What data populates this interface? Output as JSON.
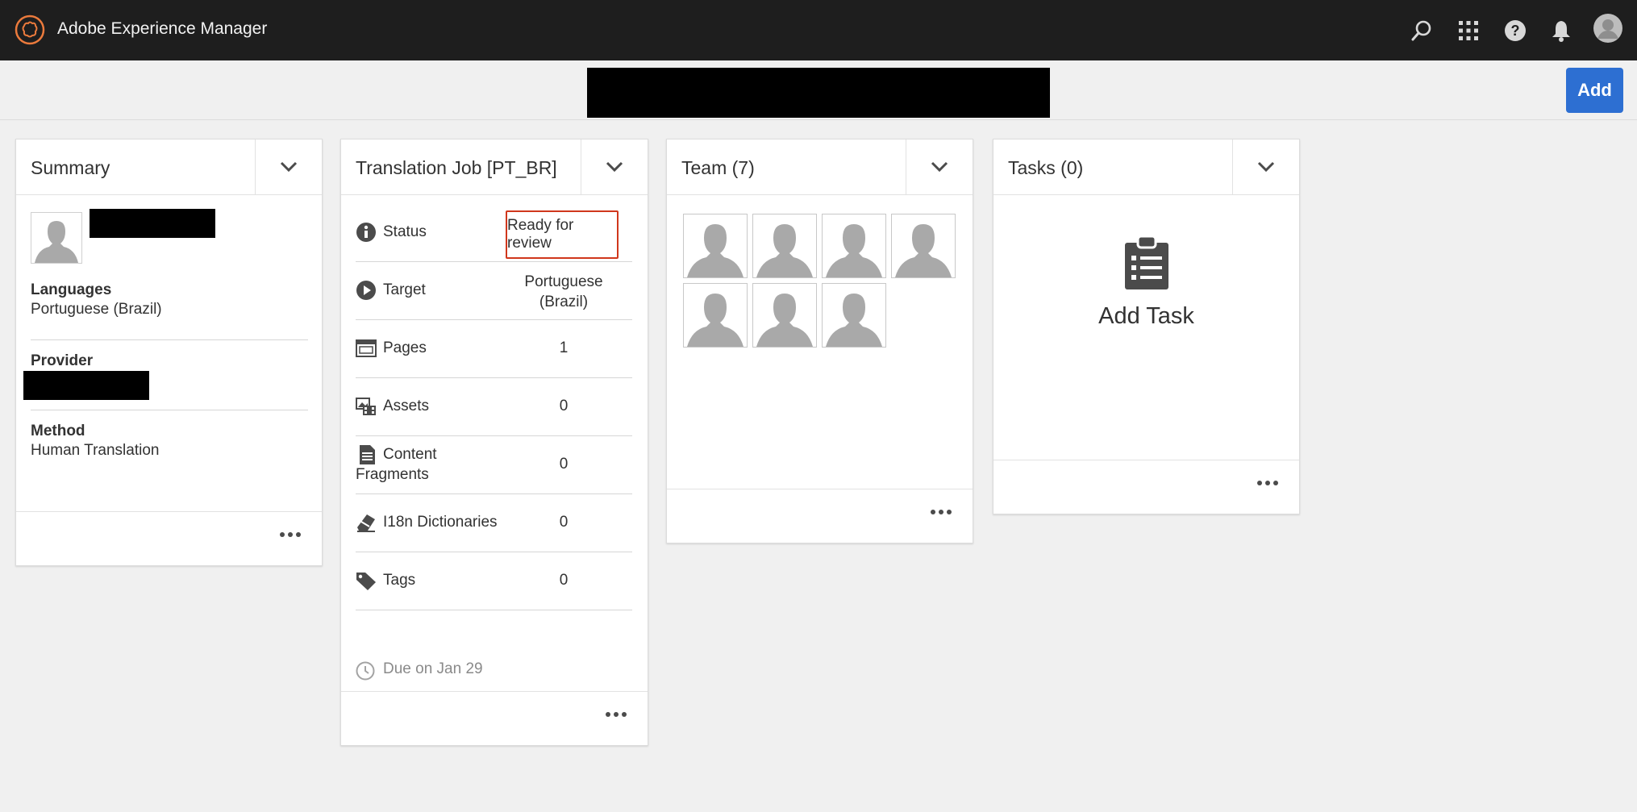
{
  "app": {
    "title": "Adobe Experience Manager"
  },
  "topbar": {
    "icons": [
      "search-icon",
      "apps-grid-icon",
      "help-icon",
      "bell-icon",
      "user-avatar"
    ]
  },
  "toolbar": {
    "add_label": "Add"
  },
  "summary": {
    "title": "Summary",
    "languages_label": "Languages",
    "languages_value": "Portuguese (Brazil)",
    "provider_label": "Provider",
    "method_label": "Method",
    "method_value": "Human Translation"
  },
  "job": {
    "title": "Translation Job [PT_BR]",
    "rows": [
      {
        "label": "Status",
        "value": "Ready for review",
        "icon": "info-icon"
      },
      {
        "label": "Target",
        "value": "Portuguese (Brazil)",
        "icon": "play-icon"
      },
      {
        "label": "Pages",
        "value": "1",
        "icon": "pages-icon"
      },
      {
        "label": "Assets",
        "value": "0",
        "icon": "assets-icon"
      },
      {
        "label": "Content Fragments",
        "value": "0",
        "icon": "document-icon"
      },
      {
        "label": "I18n Dictionaries",
        "value": "0",
        "icon": "eraser-icon"
      },
      {
        "label": "Tags",
        "value": "0",
        "icon": "tag-icon"
      }
    ],
    "due": "Due on Jan 29"
  },
  "team": {
    "title": "Team (7)",
    "member_count": 7
  },
  "tasks": {
    "title": "Tasks (0)",
    "add_label": "Add Task"
  },
  "colors": {
    "topbar": "#1e1e1e",
    "accent_blue": "#2d6fd2",
    "status_highlight": "#d0371c",
    "logo_orange": "#eb7a3c"
  }
}
